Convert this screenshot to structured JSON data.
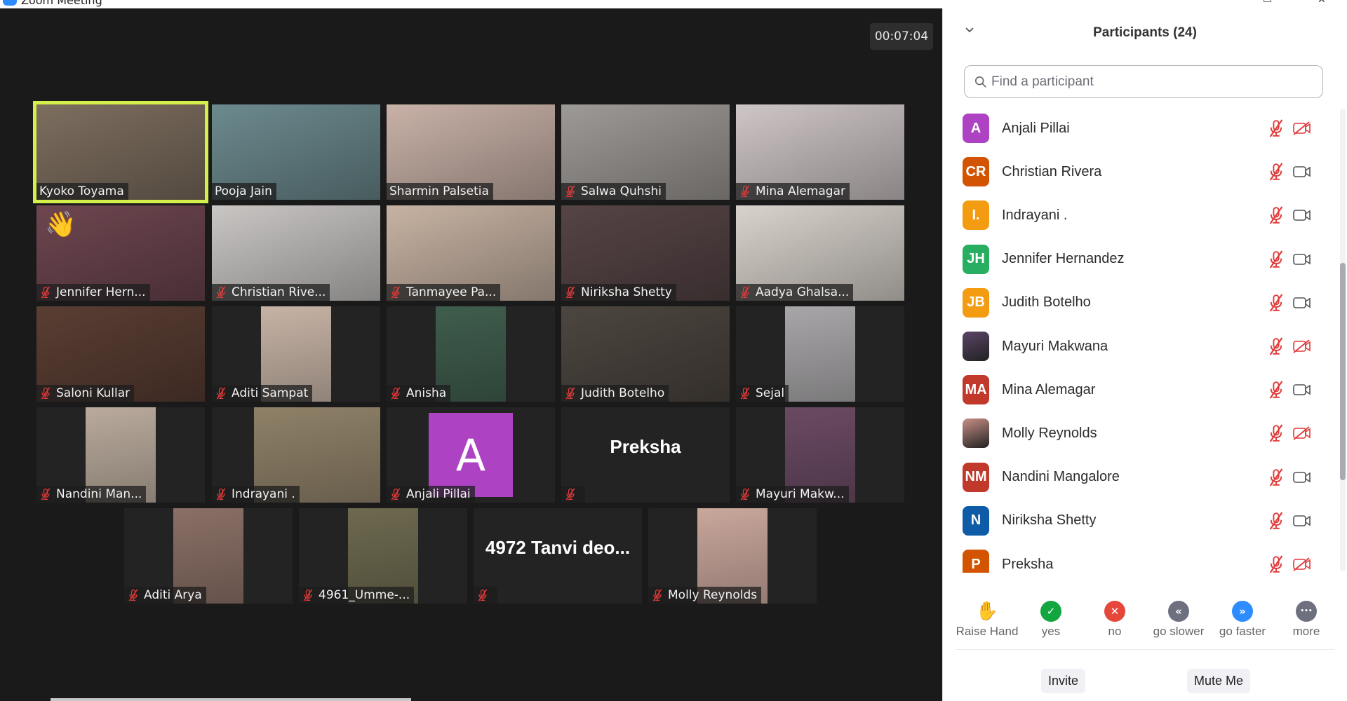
{
  "window": {
    "title": "Zoom Meeting"
  },
  "meeting": {
    "timer": "00:07:04"
  },
  "tiles": [
    {
      "name": "Kyoko Toyama",
      "muted": false,
      "active": true,
      "kind": "video",
      "bg": "#7d6e5f"
    },
    {
      "name": "Pooja Jain",
      "muted": false,
      "active": false,
      "kind": "video",
      "bg": "#6c8a8e"
    },
    {
      "name": "Sharmin Palsetia",
      "muted": false,
      "active": false,
      "kind": "video",
      "bg": "#c9b2a8"
    },
    {
      "name": "Salwa Quhshi",
      "muted": true,
      "active": false,
      "kind": "video",
      "bg": "#9e9a97"
    },
    {
      "name": "Mina Alemagar",
      "muted": true,
      "active": false,
      "kind": "video",
      "bg": "#cfc6c6"
    },
    {
      "name": "Jennifer Hern...",
      "muted": true,
      "active": false,
      "kind": "video",
      "bg": "#6e4650",
      "reaction": "👋"
    },
    {
      "name": "Christian Rive...",
      "muted": true,
      "active": false,
      "kind": "video",
      "bg": "#c9c6c4"
    },
    {
      "name": "Tanmayee Pa...",
      "muted": true,
      "active": false,
      "kind": "video",
      "bg": "#c7b3a3"
    },
    {
      "name": "Niriksha Shetty",
      "muted": true,
      "active": false,
      "kind": "video",
      "bg": "#564446"
    },
    {
      "name": "Aadya Ghalsa...",
      "muted": true,
      "active": false,
      "kind": "video",
      "bg": "#d9d3cc"
    },
    {
      "name": "Saloni Kullar",
      "muted": true,
      "active": false,
      "kind": "video",
      "bg": "#5a3e33"
    },
    {
      "name": "Aditi Sampat",
      "muted": true,
      "active": false,
      "kind": "portrait",
      "bg": "#c6b3a5"
    },
    {
      "name": "Anisha",
      "muted": true,
      "active": false,
      "kind": "portrait",
      "bg": "#3f5d4d"
    },
    {
      "name": "Judith Botelho",
      "muted": true,
      "active": false,
      "kind": "video",
      "bg": "#4d4640"
    },
    {
      "name": "Sejal",
      "muted": true,
      "active": false,
      "kind": "portrait",
      "bg": "#a8a6a8"
    },
    {
      "name": "Nandini Man...",
      "muted": true,
      "active": false,
      "kind": "portrait",
      "bg": "#b9aa9c"
    },
    {
      "name": "Indrayani .",
      "muted": true,
      "active": false,
      "kind": "portrait-wide",
      "bg": "#8f8168"
    },
    {
      "name": "Anjali Pillai",
      "muted": true,
      "active": false,
      "kind": "avatar",
      "letter": "A",
      "bg": "#ad43c3"
    },
    {
      "name": "",
      "center_name": "Preksha",
      "muted": true,
      "active": false,
      "kind": "name-only",
      "bg": "#232323"
    },
    {
      "name": "Mayuri Makw...",
      "muted": true,
      "active": false,
      "kind": "portrait",
      "bg": "#6a4a63"
    },
    {
      "name": "Aditi Arya",
      "muted": true,
      "active": false,
      "kind": "portrait",
      "bg": "#8a7066"
    },
    {
      "name": "4961_Umme-...",
      "muted": true,
      "active": false,
      "kind": "portrait",
      "bg": "#6e6a50"
    },
    {
      "name": "",
      "center_name": "4972  Tanvi  deo...",
      "muted": true,
      "active": false,
      "kind": "name-only",
      "bg": "#232323"
    },
    {
      "name": "Molly Reynolds",
      "muted": true,
      "active": false,
      "kind": "portrait",
      "bg": "#c9a79c"
    }
  ],
  "panel": {
    "title": "Participants (24)",
    "collapse_icon": "chevron-down",
    "search_placeholder": "Find a participant",
    "participants": [
      {
        "name": "Anjali Pillai",
        "initials": "A",
        "color": "#ad43c3",
        "mic_muted": true,
        "video_off": true
      },
      {
        "name": "Christian Rivera",
        "initials": "CR",
        "color": "#d35400",
        "mic_muted": true,
        "video_off": false
      },
      {
        "name": "Indrayani .",
        "initials": "I.",
        "color": "#f39c12",
        "mic_muted": true,
        "video_off": false
      },
      {
        "name": "Jennifer Hernandez",
        "initials": "JH",
        "color": "#27ae60",
        "mic_muted": true,
        "video_off": false
      },
      {
        "name": "Judith Botelho",
        "initials": "JB",
        "color": "#f39c12",
        "mic_muted": true,
        "video_off": false
      },
      {
        "name": "Mayuri Makwana",
        "initials": "",
        "color": "#5b4566",
        "photo": true,
        "mic_muted": true,
        "video_off": true
      },
      {
        "name": "Mina Alemagar",
        "initials": "MA",
        "color": "#c0392b",
        "mic_muted": true,
        "video_off": false
      },
      {
        "name": "Molly Reynolds",
        "initials": "",
        "color": "#c98f86",
        "photo": true,
        "mic_muted": true,
        "video_off": true
      },
      {
        "name": "Nandini Mangalore",
        "initials": "NM",
        "color": "#c0392b",
        "mic_muted": true,
        "video_off": false
      },
      {
        "name": "Niriksha Shetty",
        "initials": "N",
        "color": "#0e5ba7",
        "mic_muted": true,
        "video_off": false
      },
      {
        "name": "Preksha",
        "initials": "P",
        "color": "#d35400",
        "mic_muted": true,
        "video_off": true
      }
    ],
    "reactions": [
      {
        "label": "Raise Hand",
        "icon": "raise-hand",
        "color": "#2d8cff"
      },
      {
        "label": "yes",
        "icon": "check",
        "color": "#12a640"
      },
      {
        "label": "no",
        "icon": "x",
        "color": "#e5483b"
      },
      {
        "label": "go slower",
        "icon": "double-chevron-left",
        "color": "#6e7080"
      },
      {
        "label": "go faster",
        "icon": "double-chevron-right",
        "color": "#2d8cff"
      },
      {
        "label": "more",
        "icon": "ellipsis",
        "color": "#6e7080"
      }
    ],
    "buttons": {
      "invite": "Invite",
      "mute_me": "Mute Me"
    }
  },
  "colors": {
    "accent": "#2d8cff",
    "muted_red": "#e03a3a",
    "active_speaker": "#d4ef4a"
  }
}
